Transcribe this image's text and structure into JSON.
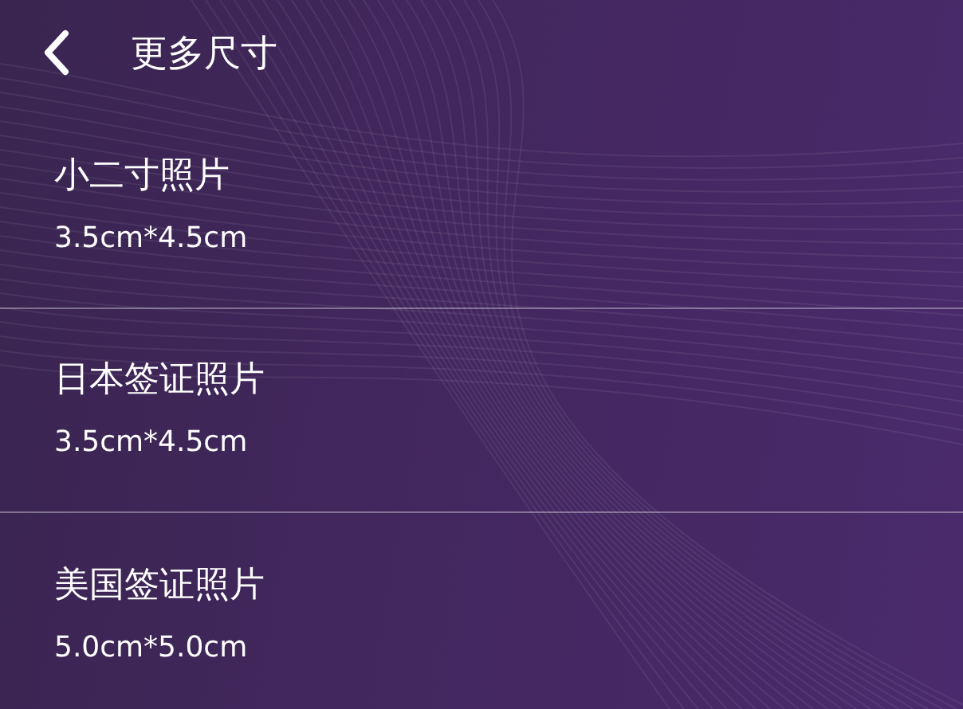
{
  "header": {
    "title": "更多尺寸"
  },
  "sizes": [
    {
      "name": "小二寸照片",
      "dimensions": "3.5cm*4.5cm"
    },
    {
      "name": "日本签证照片",
      "dimensions": "3.5cm*4.5cm"
    },
    {
      "name": "美国签证照片",
      "dimensions": "5.0cm*5.0cm"
    }
  ]
}
